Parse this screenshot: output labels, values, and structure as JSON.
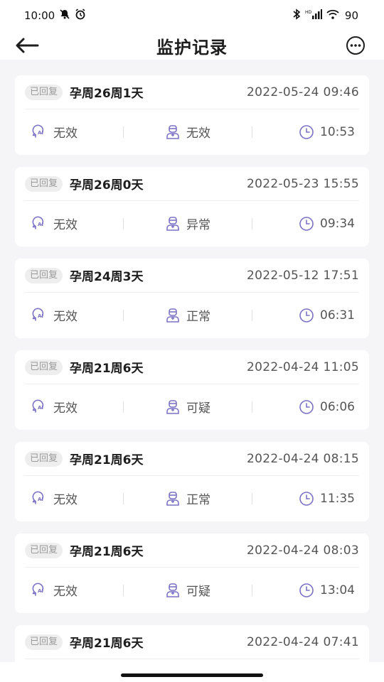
{
  "status_bar": {
    "time": "10:00",
    "battery": "90",
    "icons": [
      "mute-icon",
      "alarm-icon",
      "bluetooth-icon",
      "signal-icon",
      "wifi-icon"
    ]
  },
  "header": {
    "title": "监护记录",
    "back_icon": "arrow-left-icon",
    "more_icon": "more-circle-icon"
  },
  "colors": {
    "accent": "#7b72c6",
    "card_bg": "#ffffff",
    "page_bg": "#f5f5f7",
    "badge_bg": "#eeeeee"
  },
  "records": [
    {
      "badge": "已回复",
      "week": "孕周26周1天",
      "datetime": "2022-05-24 09:46",
      "ai_result": "无效",
      "doctor_result": "无效",
      "duration": "10:53"
    },
    {
      "badge": "已回复",
      "week": "孕周26周0天",
      "datetime": "2022-05-23 15:55",
      "ai_result": "无效",
      "doctor_result": "异常",
      "duration": "09:34"
    },
    {
      "badge": "已回复",
      "week": "孕周24周3天",
      "datetime": "2022-05-12 17:51",
      "ai_result": "无效",
      "doctor_result": "正常",
      "duration": "06:31"
    },
    {
      "badge": "已回复",
      "week": "孕周21周6天",
      "datetime": "2022-04-24 11:05",
      "ai_result": "无效",
      "doctor_result": "可疑",
      "duration": "06:06"
    },
    {
      "badge": "已回复",
      "week": "孕周21周6天",
      "datetime": "2022-04-24 08:15",
      "ai_result": "无效",
      "doctor_result": "正常",
      "duration": "11:35"
    },
    {
      "badge": "已回复",
      "week": "孕周21周6天",
      "datetime": "2022-04-24 08:03",
      "ai_result": "无效",
      "doctor_result": "可疑",
      "duration": "13:04"
    },
    {
      "badge": "已回复",
      "week": "孕周21周6天",
      "datetime": "2022-04-24 07:41",
      "ai_result": "",
      "doctor_result": "",
      "duration": ""
    }
  ]
}
